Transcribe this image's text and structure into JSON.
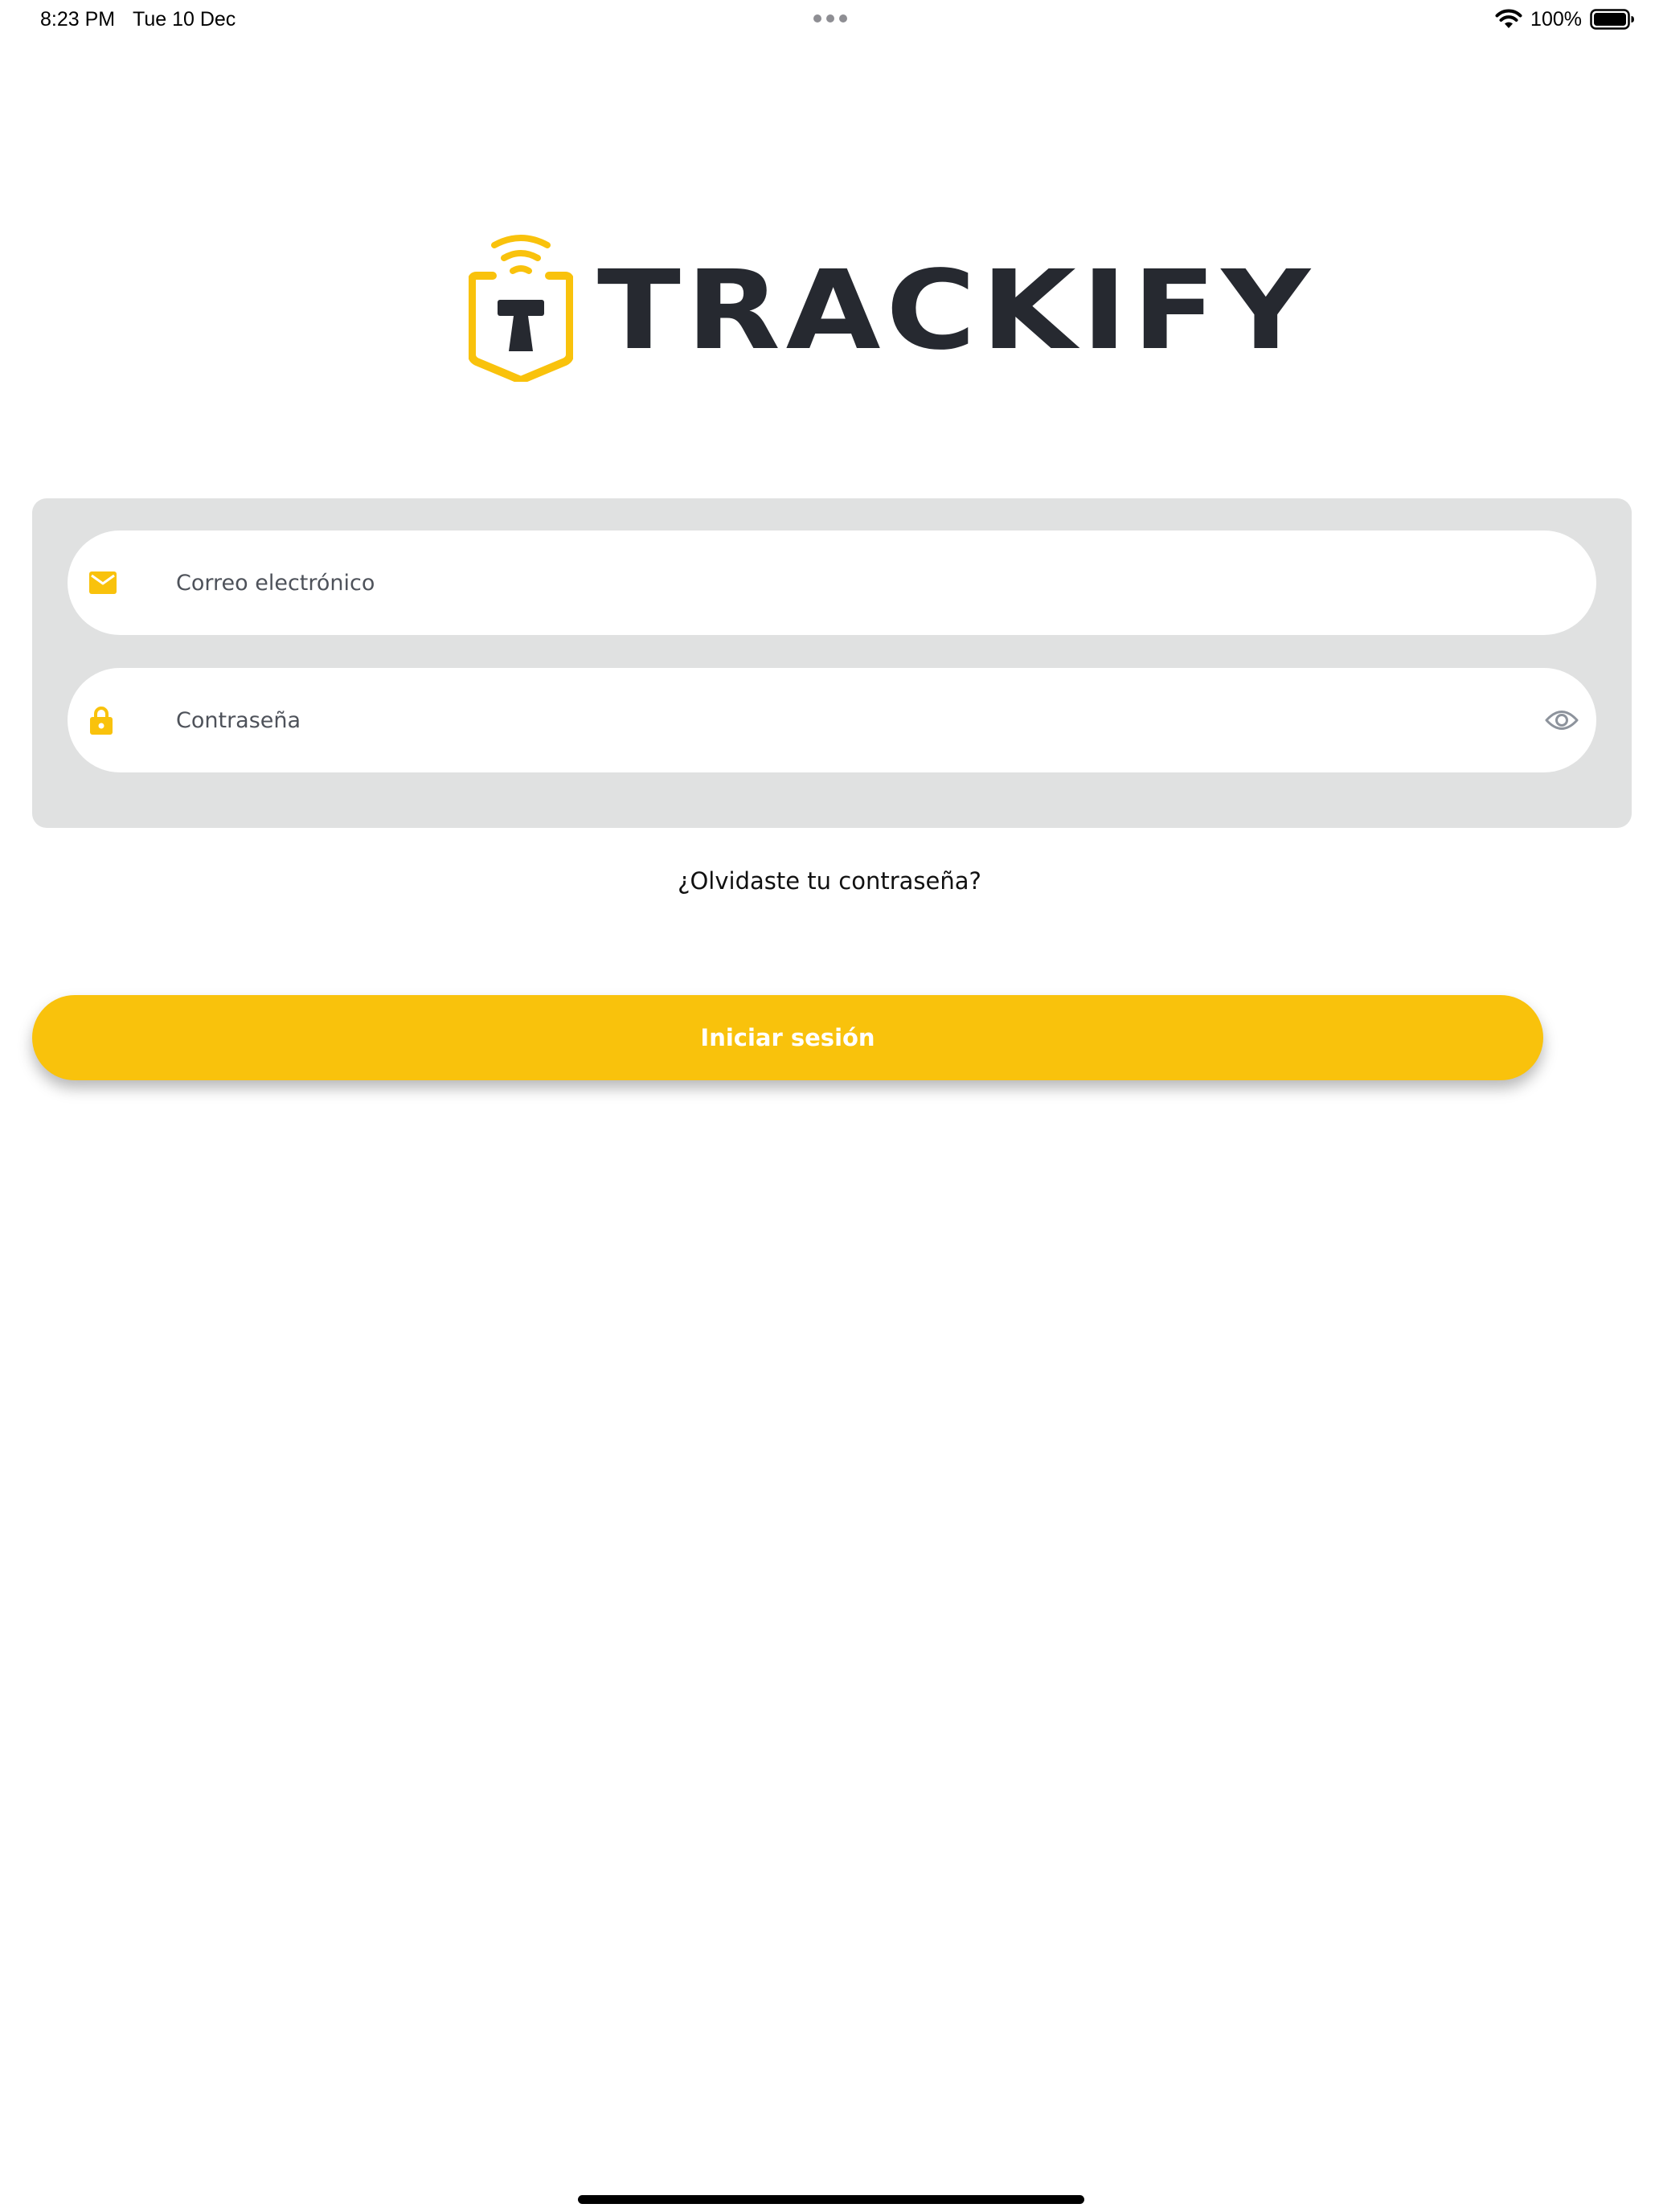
{
  "status_bar": {
    "time": "8:23 PM",
    "date": "Tue 10 Dec",
    "battery": "100%",
    "icons": [
      "multitasking-dots-icon",
      "wifi-icon",
      "battery-icon"
    ]
  },
  "brand": {
    "name": "TRACKIFY",
    "accent_color": "#F9C20C",
    "text_color": "#262930"
  },
  "form": {
    "email_placeholder": "Correo electrónico",
    "email_value": "",
    "password_placeholder": "Contraseña",
    "password_value": "",
    "email_icon": "mail-icon",
    "password_icon": "lock-icon",
    "visibility_icon": "eye-icon"
  },
  "links": {
    "forgot_password": "¿Olvidaste tu contraseña?"
  },
  "actions": {
    "login_label": "Iniciar sesión"
  }
}
